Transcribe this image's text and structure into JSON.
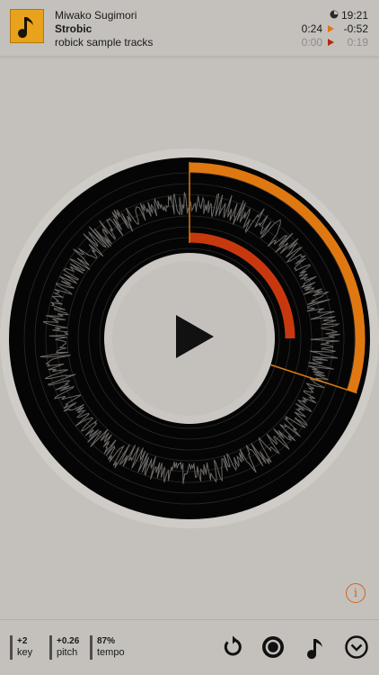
{
  "track": {
    "artist": "Miwako Sugimori",
    "title": "Strobic",
    "album": "robick sample tracks"
  },
  "status": {
    "clock": "19:21",
    "row1": {
      "elapsed": "0:24",
      "remaining": "-0:52"
    },
    "row2": {
      "elapsed": "0:00",
      "remaining": "0:19"
    }
  },
  "params": {
    "key": {
      "value": "+2",
      "label": "key"
    },
    "pitch": {
      "value": "+0.26",
      "label": "pitch"
    },
    "tempo": {
      "value": "87%",
      "label": "tempo"
    }
  },
  "progress": {
    "outer_fraction": 0.3,
    "inner_fraction": 0.25
  },
  "icons": {
    "cover": "music-note-icon",
    "clock": "clock-icon",
    "play": "play-icon",
    "info": "info-icon",
    "info_glyph": "i",
    "loop": "loop-icon",
    "disc": "disc-icon",
    "note": "music-note-icon",
    "more": "chevron-down-icon"
  },
  "colors": {
    "background": "#c4c1bd",
    "disc": "#050505",
    "outer_arc": "#e07812",
    "inner_arc": "#c8380e",
    "accent": "#d2621e",
    "cover": "#e8a21c"
  }
}
